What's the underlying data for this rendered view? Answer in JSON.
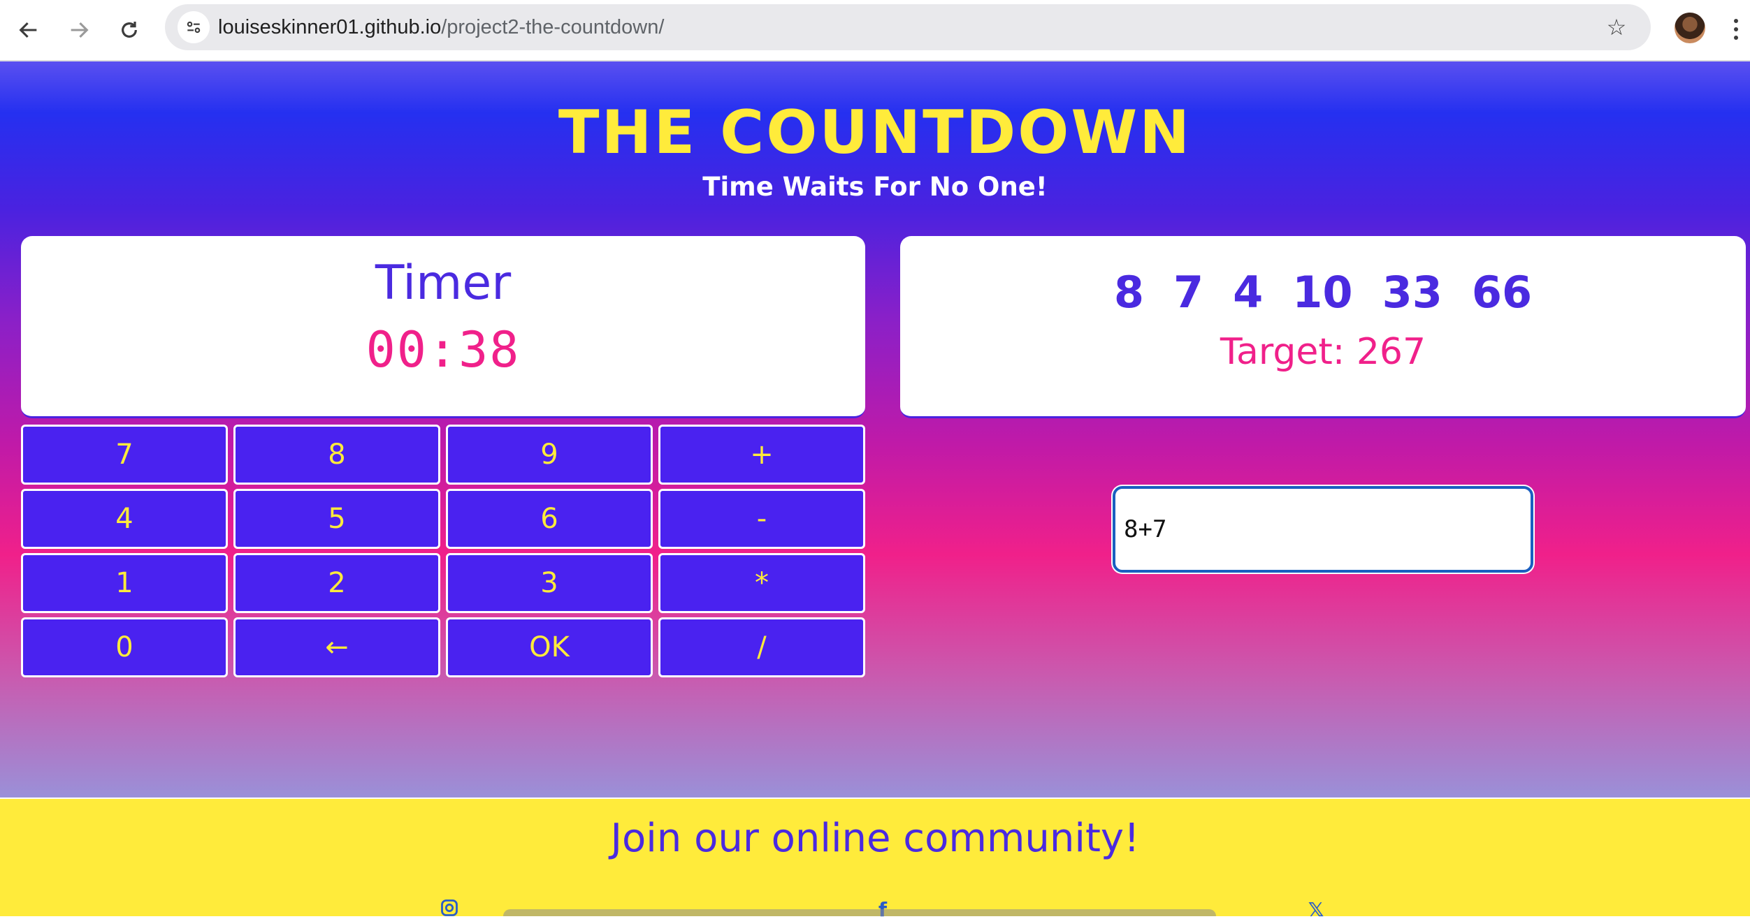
{
  "browser": {
    "url_domain": "louiseskinner01.github.io",
    "url_path": "/project2-the-countdown/"
  },
  "header": {
    "title": "THE COUNTDOWN",
    "subtitle": "Time Waits For No One!"
  },
  "timer": {
    "label": "Timer",
    "value": "00:38"
  },
  "numbers": [
    "8",
    "7",
    "4",
    "10",
    "33",
    "66"
  ],
  "target": {
    "label": "Target:",
    "value": "267"
  },
  "keypad": {
    "keys": [
      "7",
      "8",
      "9",
      "+",
      "4",
      "5",
      "6",
      "-",
      "1",
      "2",
      "3",
      "*",
      "0",
      "←",
      "OK",
      "/"
    ]
  },
  "answer": {
    "value": "8+7"
  },
  "footer": {
    "title": "Join our online community!",
    "socials": [
      "instagram-icon",
      "facebook-icon",
      "x-icon"
    ]
  },
  "colors": {
    "yellow": "#ffeb3b",
    "purple": "#4a22f0",
    "pink": "#f0208a"
  }
}
